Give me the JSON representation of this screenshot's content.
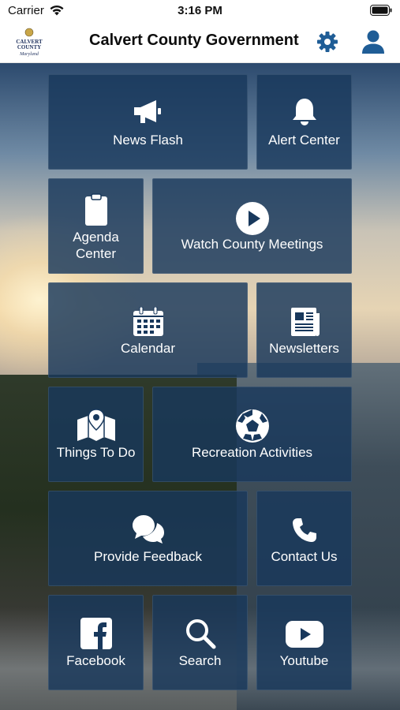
{
  "status_bar": {
    "carrier": "Carrier",
    "time": "3:16 PM"
  },
  "header": {
    "logo_alt": "Calvert County Maryland",
    "title": "Calvert County Government"
  },
  "tiles": {
    "news_flash": "News Flash",
    "alert_center": "Alert Center",
    "agenda_center_line1": "Agenda",
    "agenda_center_line2": "Center",
    "watch_meetings": "Watch County Meetings",
    "calendar": "Calendar",
    "newsletters": "Newsletters",
    "things_to_do": "Things To Do",
    "recreation": "Recreation Activities",
    "feedback": "Provide Feedback",
    "contact": "Contact Us",
    "facebook": "Facebook",
    "search": "Search",
    "youtube": "Youtube"
  },
  "colors": {
    "accent": "#1f5d96",
    "tile_bg": "#18385c"
  }
}
